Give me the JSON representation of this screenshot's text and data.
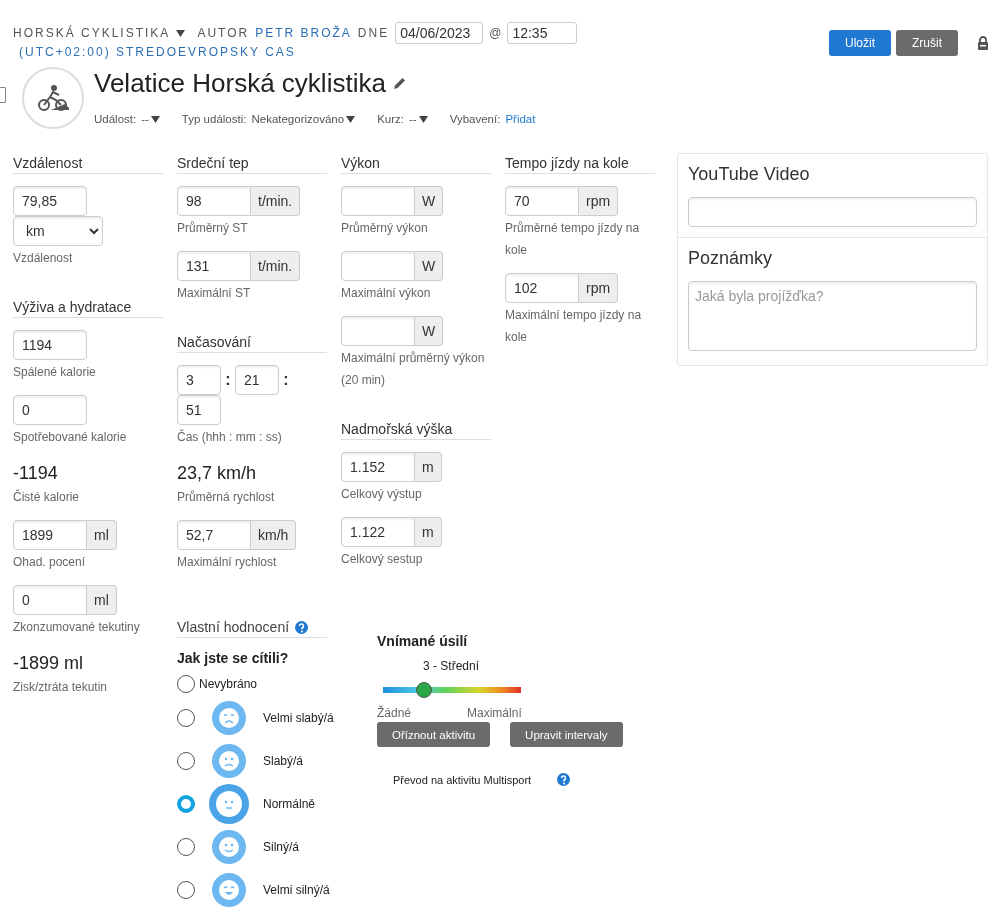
{
  "header": {
    "sport": "HORSKÁ CYKLISTIKA",
    "author_prefix": "AUTOR",
    "author": "PETR BROŽA",
    "date_prefix": "DNE",
    "date": "04/06/2023",
    "at": "@",
    "time": "12:35",
    "timezone": "(UTC+02:00) STREDOEVROPSKY CAS"
  },
  "actions": [
    {
      "label": "Uložit",
      "kind": "primary"
    },
    {
      "label": "Zrušit",
      "kind": "secondary"
    }
  ],
  "title": "Velatice Horská cyklistika",
  "meta": [
    {
      "label": "Událost:",
      "value": "--",
      "kind": "dropdown"
    },
    {
      "label": "Typ události:",
      "value": "Nekategorizováno",
      "kind": "dropdown"
    },
    {
      "label": "Kurz:",
      "value": "--",
      "kind": "dropdown"
    },
    {
      "label": "Vybavení:",
      "value": "Přidat",
      "kind": "link"
    }
  ],
  "columns": [
    [
      {
        "heading": "Vzdálenost",
        "items": [
          {
            "kind": "field",
            "value": "79,85"
          },
          {
            "kind": "select",
            "value": "km"
          },
          {
            "kind": "label",
            "text": "Vzdálenost"
          }
        ]
      },
      {
        "heading": "Výživa a hydratace",
        "items": [
          {
            "kind": "field",
            "value": "1194",
            "label": "Spálené kalorie"
          },
          {
            "kind": "field",
            "value": "0",
            "label": "Spotřebované kalorie"
          },
          {
            "kind": "stat",
            "value": "-1194",
            "label": "Čisté kalorie"
          },
          {
            "kind": "field",
            "value": "1899",
            "unit": "ml",
            "label": "Ohad. pocení"
          },
          {
            "kind": "field",
            "value": "0",
            "unit": "ml",
            "label": "Zkonzumované tekutiny"
          },
          {
            "kind": "stat",
            "value": "-1899 ml",
            "label": "Zisk/ztráta tekutin"
          }
        ]
      }
    ],
    [
      {
        "heading": "Srdeční tep",
        "items": [
          {
            "kind": "field",
            "value": "98",
            "unit": "t/min.",
            "label": "Průměrný ST"
          },
          {
            "kind": "field",
            "value": "131",
            "unit": "t/min.",
            "label": "Maximální ST"
          }
        ]
      },
      {
        "heading": "Načasování",
        "items": [
          {
            "kind": "time",
            "hours": "3",
            "sep1": ":",
            "minutes": "21",
            "sep2": ":",
            "seconds": "51",
            "label": "Čas (hhh : mm : ss)"
          },
          {
            "kind": "stat",
            "value": "23,7 km/h",
            "label": "Průměrná rychlost"
          },
          {
            "kind": "field",
            "value": "52,7",
            "unit": "km/h",
            "label": "Maximální rychlost"
          }
        ]
      }
    ],
    [
      {
        "heading": "Výkon",
        "items": [
          {
            "kind": "field",
            "unit": "W",
            "label": "Průměrný výkon"
          },
          {
            "kind": "field",
            "unit": "W",
            "label": "Maximální výkon"
          },
          {
            "kind": "field",
            "unit": "W",
            "label": "Maximální průměrný výkon (20 min)"
          }
        ]
      },
      {
        "heading": "Nadmořská výška",
        "items": [
          {
            "kind": "field",
            "value": "1.152",
            "unit": "m",
            "label": "Celkový výstup"
          },
          {
            "kind": "field",
            "value": "1.122",
            "unit": "m",
            "label": "Celkový sestup"
          }
        ]
      }
    ],
    [
      {
        "heading": "Tempo jízdy na kole",
        "items": [
          {
            "kind": "field",
            "value": "70",
            "unit": "rpm",
            "label": "Průměrné tempo jízdy na kole"
          },
          {
            "kind": "field",
            "value": "102",
            "unit": "rpm",
            "label": "Maximální tempo jízdy na kole"
          }
        ]
      }
    ]
  ],
  "self_assessment": {
    "heading": "Vlastní hodnocení",
    "question": "Jak jste se cítili?",
    "options": [
      {
        "label": "Nevybráno",
        "kind": "plain",
        "selected": false
      },
      {
        "label": "Velmi slabý/á",
        "kind": "tearful",
        "selected": false
      },
      {
        "label": "Slabý/á",
        "kind": "sad",
        "selected": false
      },
      {
        "label": "Normálně",
        "kind": "neutral",
        "selected": true
      },
      {
        "label": "Silný/á",
        "kind": "happy",
        "selected": false
      },
      {
        "label": "Velmi silný/á",
        "kind": "joyful",
        "selected": false
      }
    ]
  },
  "effort": {
    "heading": "Vnímané úsilí",
    "reading": "3 - Střední",
    "level": 0.3,
    "min_label": "Žádné",
    "max_label": "Maximální",
    "buttons": [
      "Oříznout aktivitu",
      "Upravit intervaly"
    ],
    "note": "Převod na aktivitu Multisport"
  },
  "side_panel": {
    "youtube": {
      "heading": "YouTube Video"
    },
    "notes": {
      "heading": "Poznámky",
      "placeholder": "Jaká byla projížďka?"
    }
  }
}
